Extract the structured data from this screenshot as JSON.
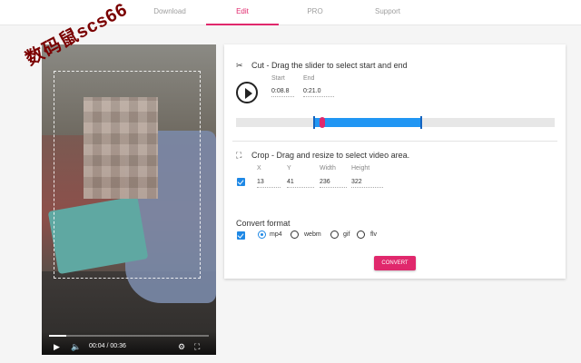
{
  "nav": {
    "tabs": [
      {
        "label": "Download",
        "active": false
      },
      {
        "label": "Edit",
        "active": true
      },
      {
        "label": "PRO",
        "active": false
      },
      {
        "label": "Support",
        "active": false
      }
    ],
    "accent_color": "#e0286c"
  },
  "video": {
    "time": "00:04 / 00:36",
    "progress_fraction": 0.11,
    "watermark": "数码鼠scs66",
    "icons": {
      "play": "play-icon",
      "volume": "volume-icon",
      "settings": "gear-icon",
      "fullscreen": "fullscreen-icon"
    }
  },
  "cut": {
    "title": "Cut - Drag the slider to select start and end",
    "start_label": "Start",
    "end_label": "End",
    "start_value": "0:08.8",
    "end_value": "0:21.0",
    "slider": {
      "range_start_fraction": 0.245,
      "range_end_fraction": 0.58,
      "marker_fraction": 0.27
    }
  },
  "crop": {
    "title": "Crop - Drag and resize to select video area.",
    "enabled": true,
    "fields": [
      {
        "label": "X",
        "value": "13"
      },
      {
        "label": "Y",
        "value": "41"
      },
      {
        "label": "Width",
        "value": "236"
      },
      {
        "label": "Height",
        "value": "322"
      }
    ]
  },
  "format": {
    "title": "Convert format",
    "enabled": true,
    "options": [
      {
        "label": "mp4",
        "checked": true
      },
      {
        "label": "webm",
        "checked": false
      },
      {
        "label": "gif",
        "checked": false
      },
      {
        "label": "flv",
        "checked": false
      }
    ],
    "convert_label": "CONVERT"
  }
}
